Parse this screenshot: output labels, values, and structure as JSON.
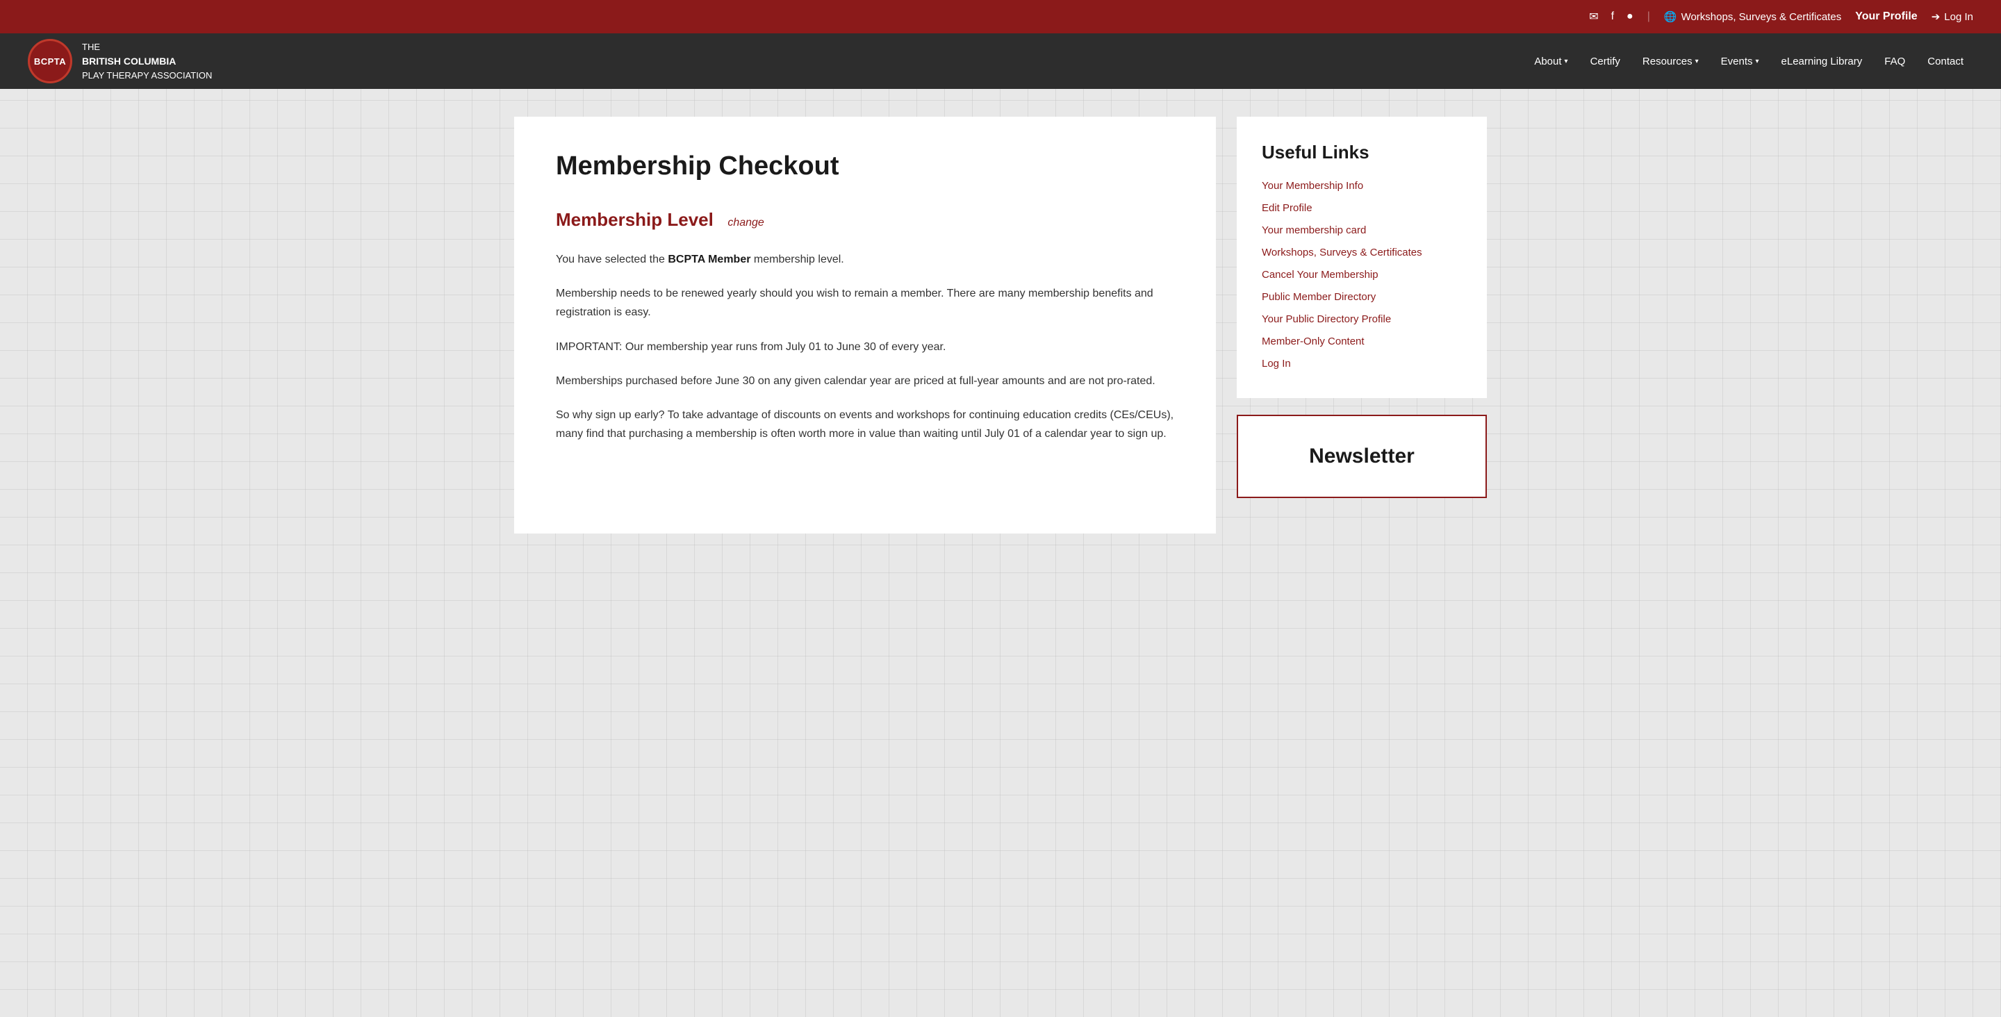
{
  "topbar": {
    "workshops_link": "Workshops, Surveys & Certificates",
    "your_profile_label": "Your Profile",
    "login_label": "Log In"
  },
  "navbar": {
    "logo_text": "BCPTA",
    "org_line1": "THE",
    "org_line2": "BRITISH COLUMBIA",
    "org_line3": "PLAY THERAPY ASSOCIATION",
    "nav_items": [
      {
        "label": "About",
        "has_dropdown": true
      },
      {
        "label": "Certify",
        "has_dropdown": false
      },
      {
        "label": "Resources",
        "has_dropdown": true
      },
      {
        "label": "Events",
        "has_dropdown": true
      },
      {
        "label": "eLearning Library",
        "has_dropdown": false
      },
      {
        "label": "FAQ",
        "has_dropdown": false
      },
      {
        "label": "Contact",
        "has_dropdown": false
      }
    ]
  },
  "main": {
    "page_title": "Membership Checkout",
    "section_title": "Membership Level",
    "change_link_label": "change",
    "selected_membership_text": "You have selected the",
    "membership_level_name": "BCPTA Member",
    "after_level_text": "membership level.",
    "paragraph1": "Membership needs to be renewed yearly should you wish to remain a member. There are many membership benefits and registration is easy.",
    "paragraph2": "IMPORTANT: Our membership year runs from July 01 to June 30 of every year.",
    "paragraph3": "Memberships purchased before June 30 on any given calendar year are priced at full-year amounts and are not pro-rated.",
    "paragraph4": "So why sign up early? To take advantage of discounts on events and workshops for continuing education credits (CEs/CEUs), many find that purchasing a membership is often worth more in value than waiting until July 01 of a calendar year to sign up."
  },
  "sidebar": {
    "useful_links_title": "Useful Links",
    "links": [
      {
        "label": "Your Membership Info"
      },
      {
        "label": "Edit Profile"
      },
      {
        "label": "Your membership card"
      },
      {
        "label": "Workshops, Surveys & Certificates"
      },
      {
        "label": "Cancel Your Membership"
      },
      {
        "label": "Public Member Directory"
      },
      {
        "label": "Your Public Directory Profile"
      },
      {
        "label": "Member-Only Content"
      },
      {
        "label": "Log In"
      }
    ],
    "newsletter_title": "Newsletter"
  }
}
